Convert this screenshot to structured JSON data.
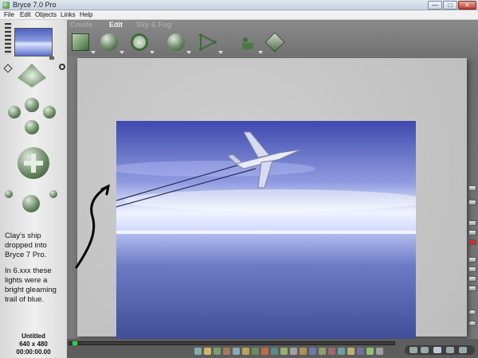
{
  "window": {
    "title": "Bryce 7.0 Pro",
    "buttons": {
      "minimize": "—",
      "maximize": "□",
      "close": "✕"
    }
  },
  "menu": [
    "File",
    "Edit",
    "Objects",
    "Links",
    "Help"
  ],
  "palettes": {
    "tabs": [
      {
        "label": "Create",
        "active": false
      },
      {
        "label": "Edit",
        "active": true
      },
      {
        "label": "Sky & Fog",
        "active": false
      }
    ],
    "tools": [
      "resize-cube-icon",
      "rotate-icon",
      "reposition-icon",
      "cube-scale-icon",
      "align-icon",
      "randomize-icon",
      "terrain-editor-icon"
    ]
  },
  "left_panel": {
    "notes": [
      "Clay's ship dropped into Bryce 7 Pro.",
      "In 6.xxx these lights were a bright gleaming trail of blue."
    ],
    "doc_name": "Untitled",
    "doc_size": "640 x 480",
    "timecode": "00:00:00.00"
  },
  "render": {
    "subject": "spaceship-icon",
    "sky_color": "#4b57b8",
    "sea_color": "#4f5ca8",
    "annotation": "hand-drawn-arrow-icon"
  },
  "colors": {
    "accent_green": "#3f7a3a",
    "timeline_head": "#2fd14a",
    "workspace": "#727272"
  }
}
